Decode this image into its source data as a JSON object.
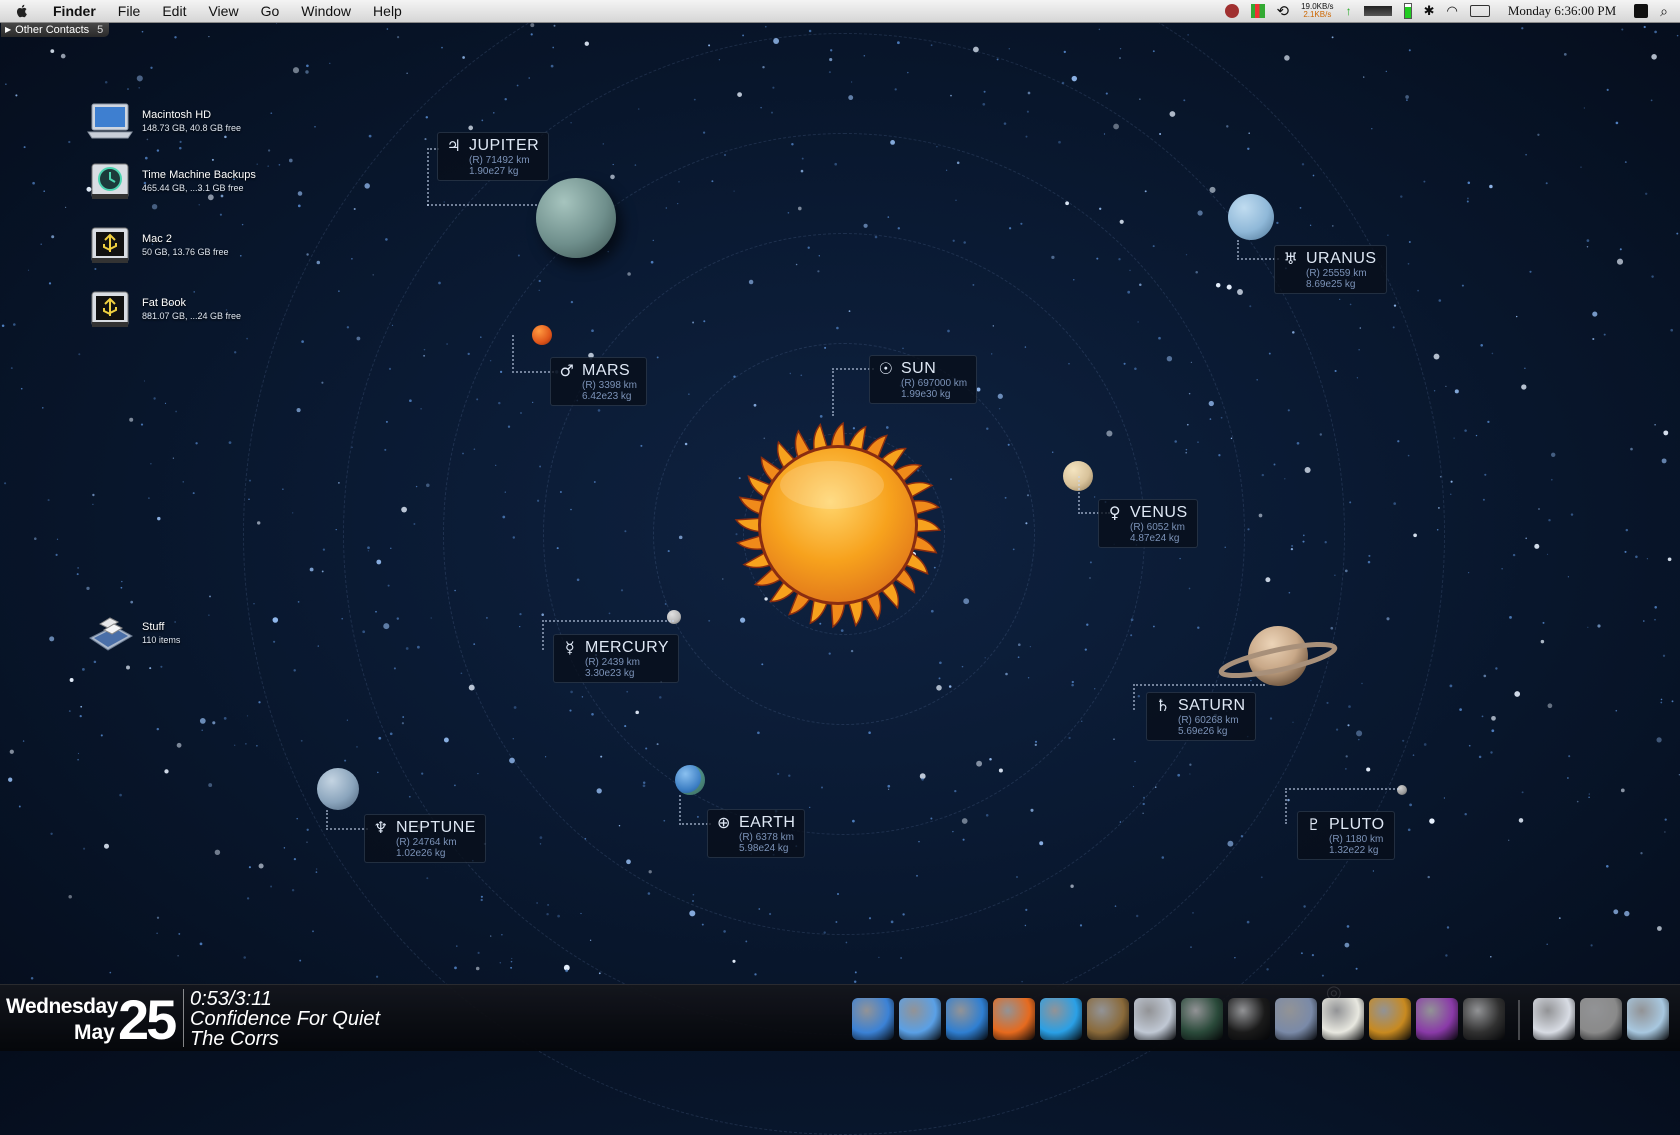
{
  "menubar": {
    "apple_icon": "apple-icon",
    "items": [
      {
        "label": "Finder",
        "bold": true
      },
      {
        "label": "File"
      },
      {
        "label": "Edit"
      },
      {
        "label": "View"
      },
      {
        "label": "Go"
      },
      {
        "label": "Window"
      },
      {
        "label": "Help"
      }
    ],
    "network_up": "19.0KB/s",
    "network_down": "2.1KB/s",
    "clock": "Monday 6:36:00 PM"
  },
  "contacts_tab": {
    "label": "Other Contacts",
    "count": "5"
  },
  "desktop_icons": [
    {
      "name": "Macintosh HD",
      "detail": "148.73 GB, 40.8 GB free",
      "icon": "laptop-drive-icon"
    },
    {
      "name": "Time Machine Backups",
      "detail": "465.44 GB, ...3.1 GB free",
      "icon": "time-machine-icon"
    },
    {
      "name": "Mac 2",
      "detail": "50 GB, 13.76 GB free",
      "icon": "usb-drive-icon"
    },
    {
      "name": "Fat Book",
      "detail": "881.07 GB, ...24 GB free",
      "icon": "usb-drive-icon"
    },
    {
      "name": "Stuff",
      "detail": "110 items",
      "icon": "network-folder-icon"
    }
  ],
  "planets": [
    {
      "name": "SUN",
      "symbol": "☉",
      "radius": "(R) 697000 km",
      "mass": "1.99e30 kg",
      "color": "#f7a21d"
    },
    {
      "name": "JUPITER",
      "symbol": "♃",
      "radius": "(R) 71492 km",
      "mass": "1.90e27 kg",
      "color": "#6f8f8c"
    },
    {
      "name": "MARS",
      "symbol": "♂",
      "radius": "(R) 3398 km",
      "mass": "6.42e23 kg",
      "color": "#e0561a"
    },
    {
      "name": "URANUS",
      "symbol": "♅",
      "radius": "(R) 25559 km",
      "mass": "8.69e25 kg",
      "color": "#8fb8d8"
    },
    {
      "name": "VENUS",
      "symbol": "♀",
      "radius": "(R) 6052 km",
      "mass": "4.87e24 kg",
      "color": "#d8c29a"
    },
    {
      "name": "MERCURY",
      "symbol": "☿",
      "radius": "(R) 2439 km",
      "mass": "3.30e23 kg",
      "color": "#b8b8b8"
    },
    {
      "name": "SATURN",
      "symbol": "♄",
      "radius": "(R) 60268 km",
      "mass": "5.69e26 kg",
      "color": "#c8a888"
    },
    {
      "name": "NEPTUNE",
      "symbol": "♆",
      "radius": "(R) 24764 km",
      "mass": "1.02e26 kg",
      "color": "#8aa4bc"
    },
    {
      "name": "EARTH",
      "symbol": "⊕",
      "radius": "(R) 6378 km",
      "mass": "5.98e24 kg",
      "color": "#3d7fc4"
    },
    {
      "name": "PLUTO",
      "symbol": "♇",
      "radius": "(R) 1180 km",
      "mass": "1.32e22 kg",
      "color": "#9a9a9a"
    }
  ],
  "date": {
    "weekday": "Wednesday",
    "month": "May",
    "day": "25"
  },
  "now_playing": {
    "time": "0:53/3:11",
    "track": "Confidence For Quiet",
    "artist": "The Corrs"
  },
  "dock": [
    {
      "name": "finder-icon",
      "color": "#3b82d6"
    },
    {
      "name": "itunes-icon",
      "color": "#5aa0e6"
    },
    {
      "name": "safari-icon",
      "color": "#2f7fd2"
    },
    {
      "name": "firefox-icon",
      "color": "#e66a1e"
    },
    {
      "name": "quicktime-icon",
      "color": "#2aa0e6"
    },
    {
      "name": "iphoto-icon",
      "color": "#8a6a3a"
    },
    {
      "name": "preview-icon",
      "color": "#c0c8d4"
    },
    {
      "name": "activity-monitor-icon",
      "color": "#2a4a3a"
    },
    {
      "name": "terminal-icon",
      "color": "#1a1a1a"
    },
    {
      "name": "script-editor-icon",
      "color": "#7a8aa8"
    },
    {
      "name": "textedit-icon",
      "color": "#e8e8e0"
    },
    {
      "name": "ring-app-icon",
      "color": "#c88a20"
    },
    {
      "name": "purple-app-icon",
      "color": "#8a3aa8"
    },
    {
      "name": "dark-app-icon",
      "color": "#303030"
    },
    {
      "name": "documents-stack-icon",
      "color": "#d8dce4"
    },
    {
      "name": "system-preferences-icon",
      "color": "#8a8a8a"
    },
    {
      "name": "trash-icon",
      "color": "#a8c8e0"
    }
  ]
}
